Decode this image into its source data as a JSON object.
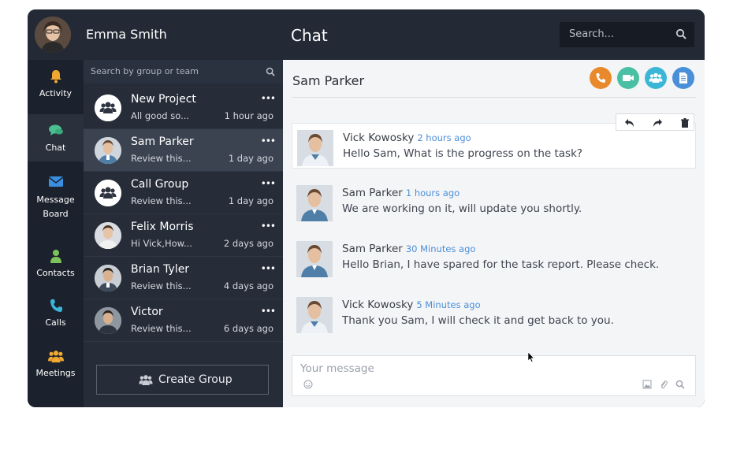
{
  "user": {
    "name": "Emma Smith"
  },
  "header": {
    "title": "Chat",
    "search_placeholder": "Search..."
  },
  "nav": {
    "items": [
      {
        "label": "Activity",
        "icon": "bell-icon"
      },
      {
        "label": "Chat",
        "icon": "chat-icon",
        "active": true
      },
      {
        "label_line1": "Message",
        "label_line2": "Board",
        "icon": "envelope-icon"
      },
      {
        "label": "Contacts",
        "icon": "person-icon"
      },
      {
        "label": "Calls",
        "icon": "phone-icon"
      },
      {
        "label": "Meetings",
        "icon": "group-icon"
      }
    ]
  },
  "conversations": {
    "search_placeholder": "Search by group or team",
    "items": [
      {
        "name": "New Project",
        "preview": "All good so...",
        "time": "1 hour ago",
        "avatar": "group-icon"
      },
      {
        "name": "Sam Parker",
        "preview": "Review this...",
        "time": "1 day ago",
        "avatar": "user-photo",
        "active": true
      },
      {
        "name": "Call Group",
        "preview": "Review this...",
        "time": "1 day ago",
        "avatar": "group-icon"
      },
      {
        "name": "Felix Morris",
        "preview": "Hi Vick,How...",
        "time": "2 days ago",
        "avatar": "user-photo"
      },
      {
        "name": "Brian Tyler",
        "preview": "Review this...",
        "time": "4 days ago",
        "avatar": "user-photo"
      },
      {
        "name": "Victor",
        "preview": "Review this...",
        "time": "6 days ago",
        "avatar": "user-photo"
      }
    ],
    "more_label": "•••",
    "create_group_label": "Create Group"
  },
  "chat": {
    "peer_name": "Sam Parker",
    "actions": [
      {
        "icon": "phone-icon",
        "color": "#e8892b"
      },
      {
        "icon": "video-icon",
        "color": "#4bbfa4"
      },
      {
        "icon": "group-icon",
        "color": "#3bb6d6"
      },
      {
        "icon": "document-icon",
        "color": "#4a90d9"
      }
    ],
    "messages": [
      {
        "sender": "Vick Kowosky",
        "ago": "2 hours ago",
        "text": "Hello Sam, What is the progress on the task?"
      },
      {
        "sender": "Sam Parker",
        "ago": "1 hours ago",
        "text": "We are working on it, will update you shortly."
      },
      {
        "sender": "Sam Parker",
        "ago": "30 Minutes ago",
        "text": "Hello Brian, I have spared for the task report. Please check."
      },
      {
        "sender": "Vick Kowosky",
        "ago": "5 Minutes ago",
        "text": "Thank you Sam, I will check it and get back to you."
      }
    ],
    "composer_placeholder": "Your message"
  }
}
